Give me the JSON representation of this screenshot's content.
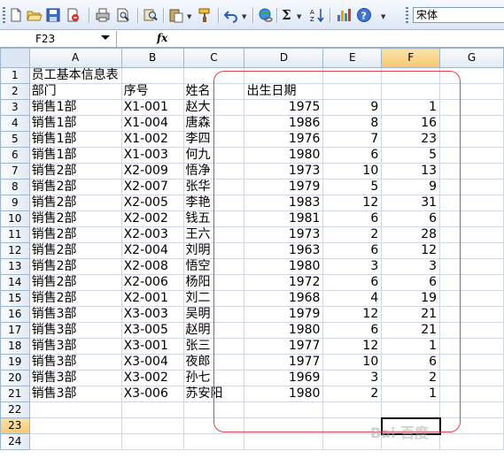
{
  "toolbar": {
    "font_name": "宋体",
    "buttons": [
      "new-icon",
      "open-icon",
      "save-icon",
      "permission-icon",
      "print-icon",
      "print-preview-icon",
      "research-icon",
      "paste-icon",
      "format-painter-icon",
      "undo-icon",
      "hyperlink-icon",
      "autosum-icon",
      "sort-ascending-icon",
      "chart-wizard-icon",
      "help-icon"
    ]
  },
  "formula_bar": {
    "name_box": "F23",
    "fx_label": "fx",
    "formula": ""
  },
  "sheet": {
    "columns": [
      "A",
      "B",
      "C",
      "D",
      "E",
      "F",
      "G"
    ],
    "selected_cell": "F23",
    "rows": [
      {
        "n": "1",
        "a": "员工基本信息表",
        "b": "",
        "c": "",
        "d": "",
        "e": "",
        "f": ""
      },
      {
        "n": "2",
        "a": "部门",
        "b": "序号",
        "c": "姓名",
        "d": "出生日期",
        "e": "",
        "f": ""
      },
      {
        "n": "3",
        "a": "销售1部",
        "b": "X1-001",
        "c": "赵大",
        "d": "1975",
        "e": "9",
        "f": "1"
      },
      {
        "n": "4",
        "a": "销售1部",
        "b": "X1-004",
        "c": "唐森",
        "d": "1986",
        "e": "8",
        "f": "16"
      },
      {
        "n": "5",
        "a": "销售1部",
        "b": "X1-002",
        "c": "李四",
        "d": "1976",
        "e": "7",
        "f": "23"
      },
      {
        "n": "6",
        "a": "销售1部",
        "b": "X1-003",
        "c": "何九",
        "d": "1980",
        "e": "6",
        "f": "5"
      },
      {
        "n": "7",
        "a": "销售2部",
        "b": "X2-009",
        "c": "悟净",
        "d": "1973",
        "e": "10",
        "f": "13"
      },
      {
        "n": "8",
        "a": "销售2部",
        "b": "X2-007",
        "c": "张华",
        "d": "1979",
        "e": "5",
        "f": "9"
      },
      {
        "n": "9",
        "a": "销售2部",
        "b": "X2-005",
        "c": "李艳",
        "d": "1983",
        "e": "12",
        "f": "31"
      },
      {
        "n": "10",
        "a": "销售2部",
        "b": "X2-002",
        "c": "钱五",
        "d": "1981",
        "e": "6",
        "f": "6"
      },
      {
        "n": "11",
        "a": "销售2部",
        "b": "X2-003",
        "c": "王六",
        "d": "1973",
        "e": "2",
        "f": "28"
      },
      {
        "n": "12",
        "a": "销售2部",
        "b": "X2-004",
        "c": "刘明",
        "d": "1963",
        "e": "6",
        "f": "12"
      },
      {
        "n": "13",
        "a": "销售2部",
        "b": "X2-008",
        "c": "悟空",
        "d": "1980",
        "e": "3",
        "f": "3"
      },
      {
        "n": "14",
        "a": "销售2部",
        "b": "X2-006",
        "c": "杨阳",
        "d": "1972",
        "e": "6",
        "f": "6"
      },
      {
        "n": "15",
        "a": "销售2部",
        "b": "X2-001",
        "c": "刘二",
        "d": "1968",
        "e": "4",
        "f": "19"
      },
      {
        "n": "16",
        "a": "销售3部",
        "b": "X3-003",
        "c": "吴明",
        "d": "1979",
        "e": "12",
        "f": "21"
      },
      {
        "n": "17",
        "a": "销售3部",
        "b": "X3-005",
        "c": "赵明",
        "d": "1980",
        "e": "6",
        "f": "21"
      },
      {
        "n": "18",
        "a": "销售3部",
        "b": "X3-001",
        "c": "张三",
        "d": "1977",
        "e": "12",
        "f": "1"
      },
      {
        "n": "19",
        "a": "销售3部",
        "b": "X3-004",
        "c": "夜郎",
        "d": "1977",
        "e": "10",
        "f": "6"
      },
      {
        "n": "20",
        "a": "销售3部",
        "b": "X3-002",
        "c": "孙七",
        "d": "1969",
        "e": "3",
        "f": "2"
      },
      {
        "n": "21",
        "a": "销售3部",
        "b": "X3-006",
        "c": "苏安阳",
        "d": "1980",
        "e": "2",
        "f": "1"
      },
      {
        "n": "22",
        "a": "",
        "b": "",
        "c": "",
        "d": "",
        "e": "",
        "f": ""
      },
      {
        "n": "23",
        "a": "",
        "b": "",
        "c": "",
        "d": "",
        "e": "",
        "f": ""
      },
      {
        "n": "24",
        "a": "",
        "b": "",
        "c": "",
        "d": "",
        "e": "",
        "f": ""
      }
    ]
  },
  "watermark": "Bai 百度"
}
